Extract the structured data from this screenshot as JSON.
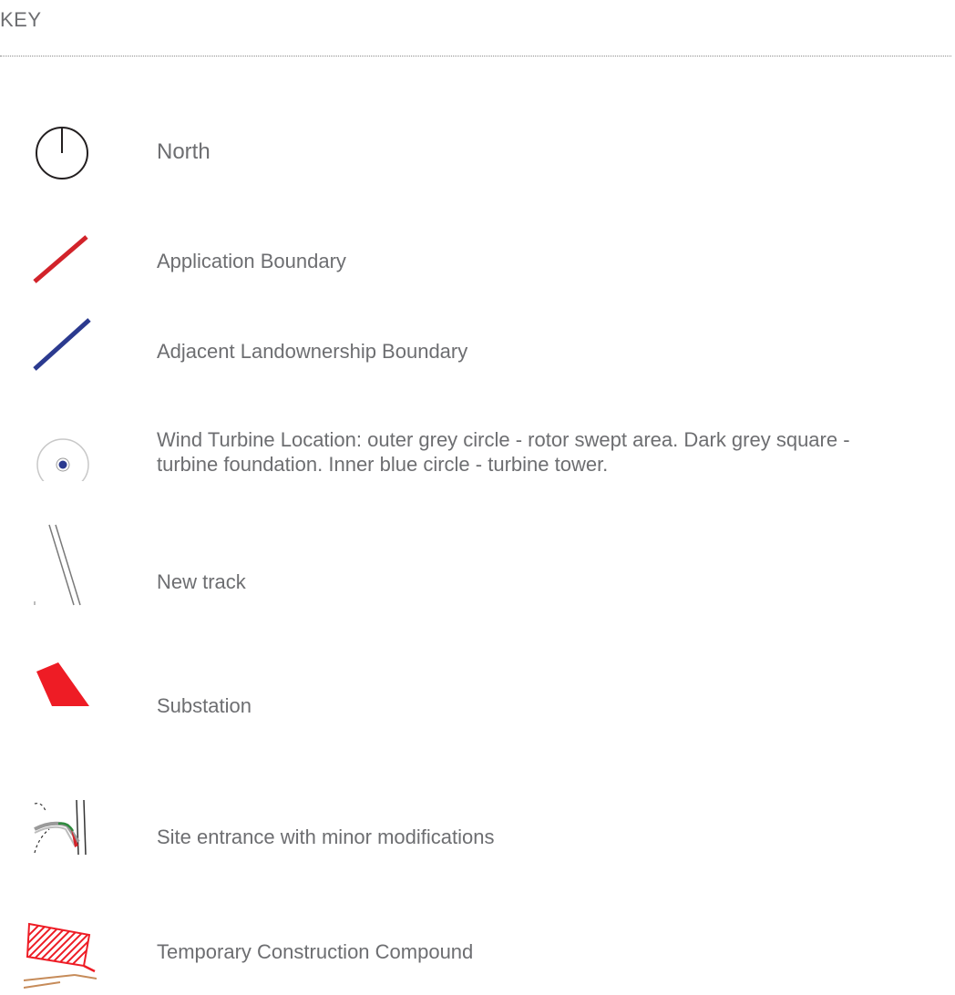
{
  "key": {
    "title": "KEY",
    "items": [
      {
        "label": "North",
        "icon": "north-arrow-icon"
      },
      {
        "label": "Application Boundary",
        "icon": "red-boundary-line-icon",
        "color": "#d2232a"
      },
      {
        "label": "Adjacent Landownership Boundary",
        "icon": "blue-boundary-line-icon",
        "color": "#2b3a8f"
      },
      {
        "label": "Wind Turbine Location: outer grey circle  - rotor swept area. Dark grey square - turbine foundation. Inner blue circle - turbine tower.",
        "icon": "wind-turbine-icon",
        "color": "#2b3a8f"
      },
      {
        "label": "New track",
        "icon": "new-track-icon"
      },
      {
        "label": "Substation",
        "icon": "substation-icon",
        "color": "#ee1c25"
      },
      {
        "label": "Site entrance with minor modifications",
        "icon": "site-entrance-icon"
      },
      {
        "label": "Temporary Construction Compound",
        "icon": "construction-compound-icon",
        "color": "#ee1c25"
      }
    ]
  }
}
